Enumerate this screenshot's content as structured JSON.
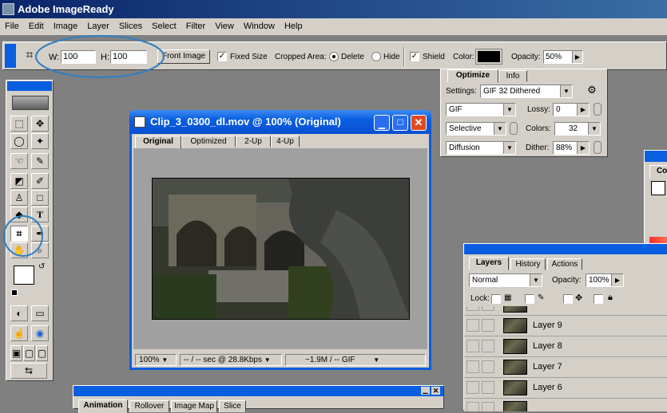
{
  "app": {
    "title": "Adobe ImageReady"
  },
  "menu": [
    "File",
    "Edit",
    "Image",
    "Layer",
    "Slices",
    "Select",
    "Filter",
    "View",
    "Window",
    "Help"
  ],
  "options_bar": {
    "w_label": "W:",
    "w_value": "100",
    "h_label": "H:",
    "h_value": "100",
    "front_image": "Front Image",
    "fixed_size": "Fixed Size",
    "cropped_area": "Cropped Area:",
    "delete": "Delete",
    "hide": "Hide",
    "shield": "Shield",
    "color": "Color:",
    "opacity_label": "Opacity:",
    "opacity_value": "50%"
  },
  "optimize": {
    "tabs": [
      "Optimize",
      "Info"
    ],
    "settings_label": "Settings:",
    "settings_value": "GIF 32 Dithered",
    "format": "GIF",
    "lossy_label": "Lossy:",
    "lossy_value": "0",
    "palette": "Selective",
    "colors_label": "Colors:",
    "colors_value": "32",
    "dither_algo": "Diffusion",
    "dither_label": "Dither:",
    "dither_value": "88%"
  },
  "doc": {
    "title": "Clip_3_0300_dl.mov @ 100% (Original)",
    "tabs": [
      "Original",
      "Optimized",
      "2-Up",
      "4-Up"
    ],
    "zoom": "100%",
    "speed": "-- / -- sec @ 28.8Kbps",
    "size": "~1.9M / -- GIF"
  },
  "color_panel": {
    "tab": "Col"
  },
  "layers": {
    "tabs": [
      "Layers",
      "History",
      "Actions"
    ],
    "blend": "Normal",
    "opacity_label": "Opacity:",
    "opacity_value": "100%",
    "lock_label": "Lock:",
    "items": [
      "Layer 9",
      "Layer 8",
      "Layer 7",
      "Layer 6"
    ]
  },
  "animation": {
    "tabs": [
      "Animation",
      "Rollover",
      "Image Map",
      "Slice"
    ]
  },
  "colors": {
    "annotation": "#2f7fc1",
    "selection_title": "#0a5ee0"
  }
}
